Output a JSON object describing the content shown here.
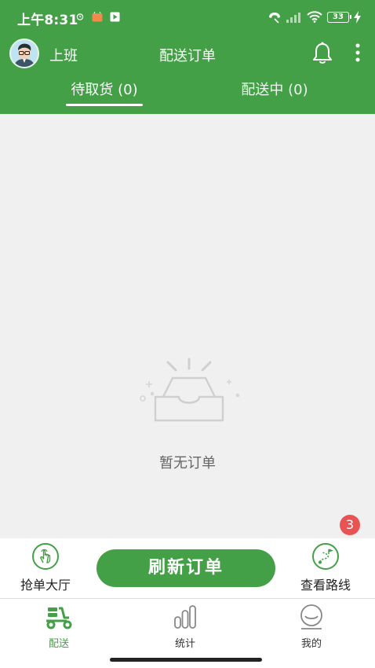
{
  "status_bar": {
    "time": "上午8:31",
    "battery": "33"
  },
  "header": {
    "work_status": "上班",
    "title": "配送订单",
    "tabs": [
      {
        "label": "待取货 (0)",
        "active": true
      },
      {
        "label": "配送中 (0)",
        "active": false
      }
    ]
  },
  "content": {
    "empty_text": "暂无订单",
    "route_badge": "3"
  },
  "actions": {
    "left_label": "抢单大厅",
    "refresh_label": "刷新订单",
    "right_label": "查看路线"
  },
  "bottom_nav": {
    "items": [
      {
        "label": "配送",
        "icon": "delivery-scooter-icon",
        "active": true
      },
      {
        "label": "统计",
        "icon": "stats-bars-icon",
        "active": false
      },
      {
        "label": "我的",
        "icon": "profile-icon",
        "active": false
      }
    ]
  },
  "colors": {
    "primary": "#43a047",
    "badge": "#e95353",
    "content_bg": "#f0f0f0"
  }
}
